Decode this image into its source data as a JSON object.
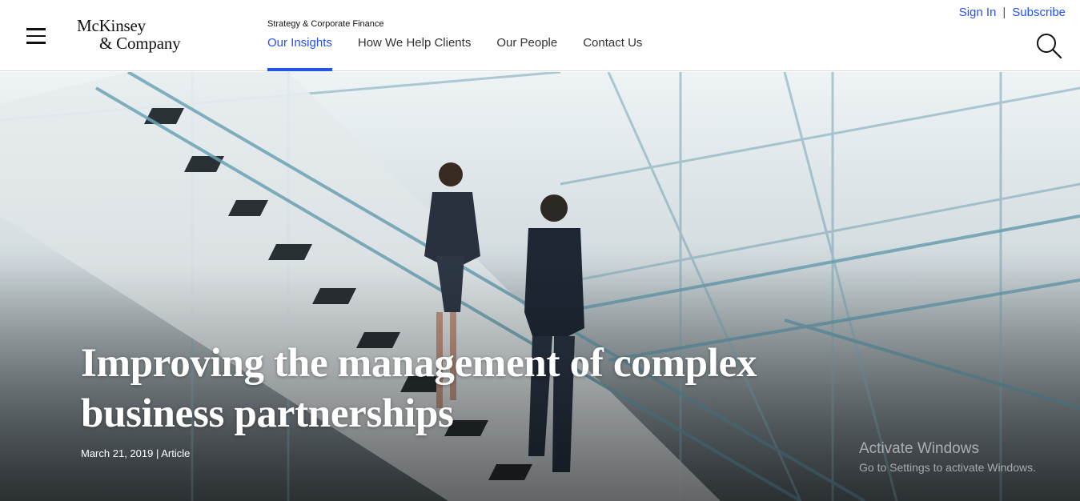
{
  "header": {
    "logo_line1": "McKinsey",
    "logo_line2": "& Company",
    "section_label": "Strategy & Corporate Finance",
    "nav": [
      {
        "label": "Our Insights",
        "active": true
      },
      {
        "label": "How We Help Clients",
        "active": false
      },
      {
        "label": "Our People",
        "active": false
      },
      {
        "label": "Contact Us",
        "active": false
      }
    ],
    "sign_in": "Sign In",
    "separator": "|",
    "subscribe": "Subscribe"
  },
  "hero": {
    "title_line1": "Improving the management of complex",
    "title_line2": "business partnerships",
    "meta": "March 21, 2019 | Article"
  },
  "watermark": {
    "line1": "Activate Windows",
    "line2": "Go to Settings to activate Windows."
  },
  "colors": {
    "accent": "#2251ff",
    "text": "#222222",
    "hero_text": "#ffffff"
  },
  "icons": [
    "menu-icon",
    "search-icon"
  ]
}
